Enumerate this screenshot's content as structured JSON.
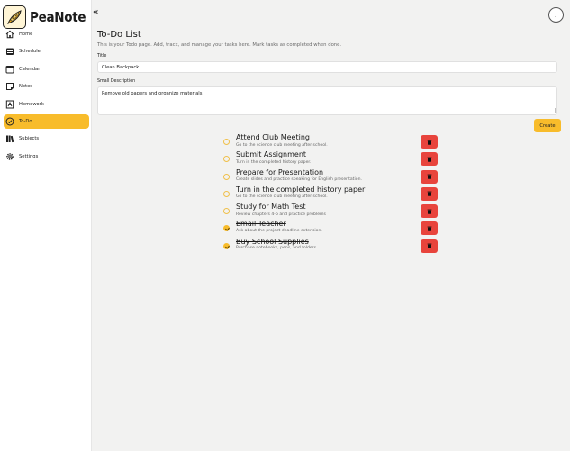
{
  "app": {
    "name": "PeaNote"
  },
  "user": {
    "initial": "J"
  },
  "sidebar": {
    "items": [
      {
        "label": "Home",
        "icon": "home-icon",
        "active": false
      },
      {
        "label": "Schedule",
        "icon": "schedule-icon",
        "active": false
      },
      {
        "label": "Calendar",
        "icon": "calendar-icon",
        "active": false
      },
      {
        "label": "Notes",
        "icon": "notes-icon",
        "active": false
      },
      {
        "label": "Homework",
        "icon": "homework-icon",
        "active": false
      },
      {
        "label": "To-Do",
        "icon": "todo-check-icon",
        "active": true
      },
      {
        "label": "Subjects",
        "icon": "subjects-icon",
        "active": false
      },
      {
        "label": "Settings",
        "icon": "settings-gear-icon",
        "active": false
      }
    ]
  },
  "page": {
    "title": "To-Do List",
    "description": "This is your Todo page. Add, track, and manage your tasks here. Mark tasks as completed when done."
  },
  "form": {
    "title_label": "Title",
    "title_value": "Clean Backpack",
    "desc_label": "Small Description",
    "desc_value": "Remove old papers and organize materials",
    "create_label": "Create"
  },
  "todos": [
    {
      "title": "Attend Club Meeting",
      "description": "Go to the science club meeting after school.",
      "done": false
    },
    {
      "title": "Submit Assignment",
      "description": "Turn in the completed history paper.",
      "done": false
    },
    {
      "title": "Prepare for Presentation",
      "description": "Create slides and practice speaking for English presentation.",
      "done": false
    },
    {
      "title": "Turn in the completed history paper",
      "description": "Go to the science club meeting after school.",
      "done": false
    },
    {
      "title": "Study for Math Test",
      "description": "Review chapters 4-6 and practice problems",
      "done": false
    },
    {
      "title": "Email Teacher",
      "description": "Ask about the project deadline extension.",
      "done": true
    },
    {
      "title": "Buy School Supplies",
      "description": "Purchase notebooks, pens, and folders.",
      "done": true
    }
  ],
  "colors": {
    "accent": "#f8bc2b",
    "delete": "#e8443c",
    "background": "#f2f2f1"
  }
}
